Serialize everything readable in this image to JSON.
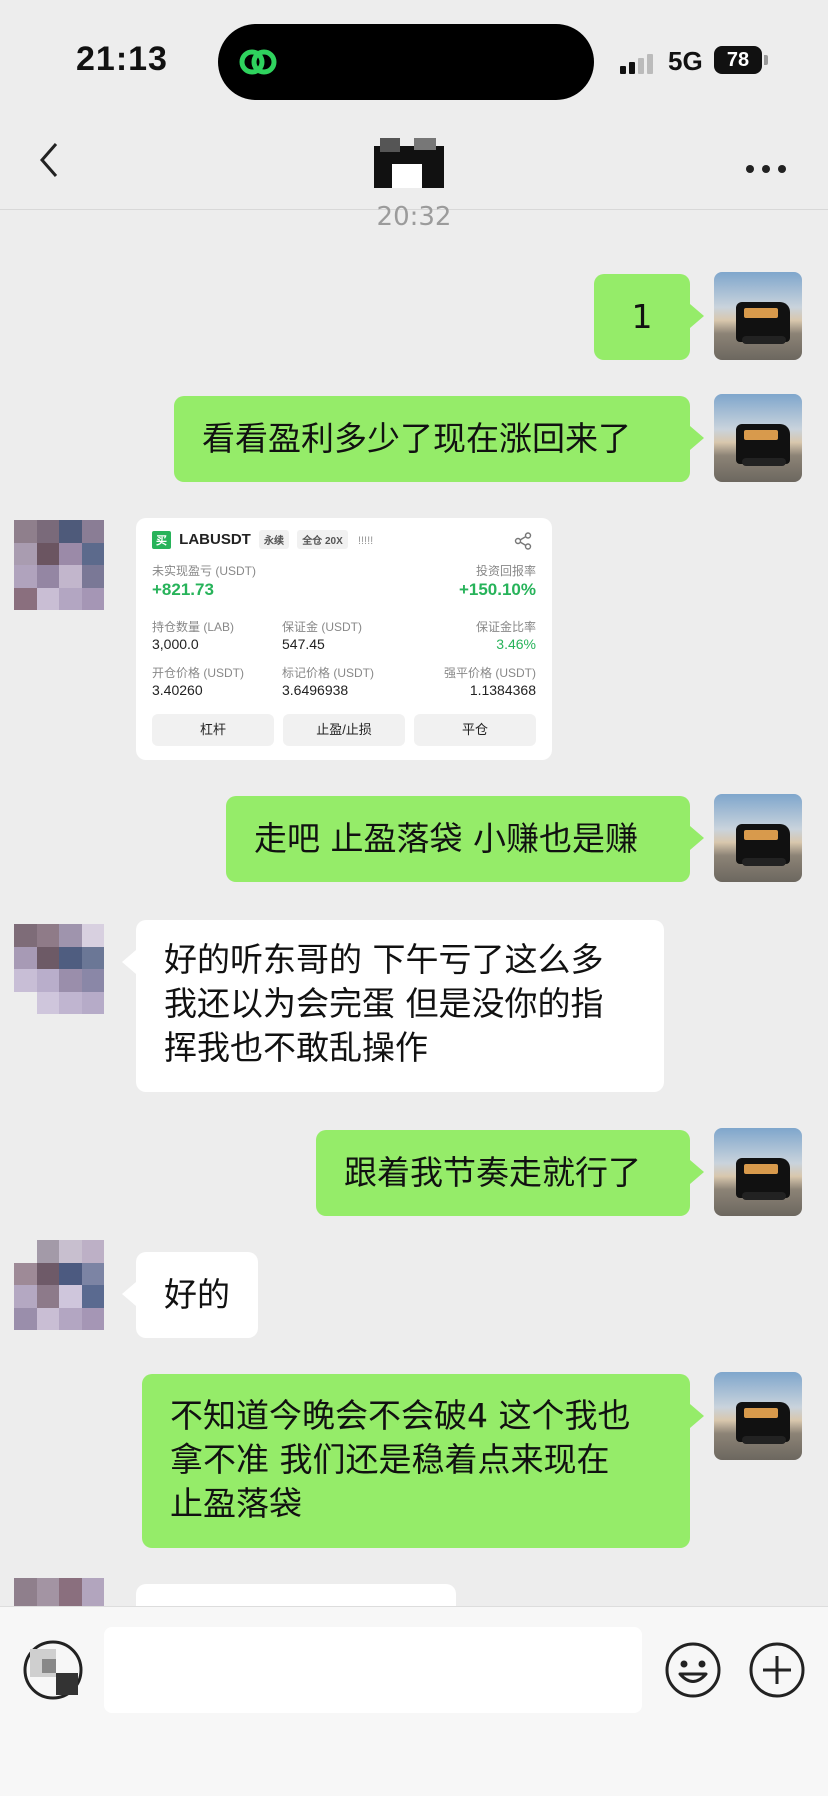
{
  "status": {
    "time": "21:13",
    "network": "5G",
    "battery": "78"
  },
  "nav": {
    "title": ""
  },
  "timestamp": "20:32",
  "messages": [
    {
      "from": "me",
      "text": "1"
    },
    {
      "from": "me",
      "text": "看看盈利多少了现在涨回来了"
    },
    {
      "from": "other",
      "type": "trade-card"
    },
    {
      "from": "me",
      "text": "走吧 止盈落袋 小赚也是赚"
    },
    {
      "from": "other",
      "lines": [
        "好的听东哥的 下午亏了这么多",
        "我还以为会完蛋 但是没你的指",
        "挥我也不敢乱操作"
      ]
    },
    {
      "from": "me",
      "text": "跟着我节奏走就行了"
    },
    {
      "from": "other",
      "text": "好的"
    },
    {
      "from": "me",
      "lines": [
        "不知道今晚会不会破4 这个我也",
        "拿不准 我们还是稳着点来现在",
        "止盈落袋"
      ]
    },
    {
      "from": "other",
      "text": ""
    }
  ],
  "trade_card": {
    "buy_tag": "买",
    "symbol": "LABUSDT",
    "perp": "永续",
    "margin_mode": "全仓 20X",
    "bars": "!!!!!",
    "unrealized_label": "未实现盈亏 (USDT)",
    "unrealized_value": "+821.73",
    "roi_label": "投资回报率",
    "roi_value": "+150.10%",
    "position_label": "持仓数量 (LAB)",
    "position_value": "3,000.0",
    "margin_label": "保证金 (USDT)",
    "margin_value": "547.45",
    "margin_ratio_label": "保证金比率",
    "margin_ratio_value": "3.46%",
    "entry_label": "开仓价格 (USDT)",
    "entry_value": "3.40260",
    "mark_label": "标记价格 (USDT)",
    "mark_value": "3.6496938",
    "liq_label": "强平价格 (USDT)",
    "liq_value": "1.1384368",
    "buttons": [
      "杠杆",
      "止盈/止损",
      "平仓"
    ]
  },
  "colors": {
    "accent_green": "#95ec69",
    "profit_green": "#27b35a",
    "background": "#ededed"
  },
  "icons": {
    "back": "chevron-left-icon",
    "more": "more-icon",
    "voice": "voice-icon",
    "emoji": "emoji-icon",
    "plus": "plus-icon",
    "share": "share-icon"
  }
}
